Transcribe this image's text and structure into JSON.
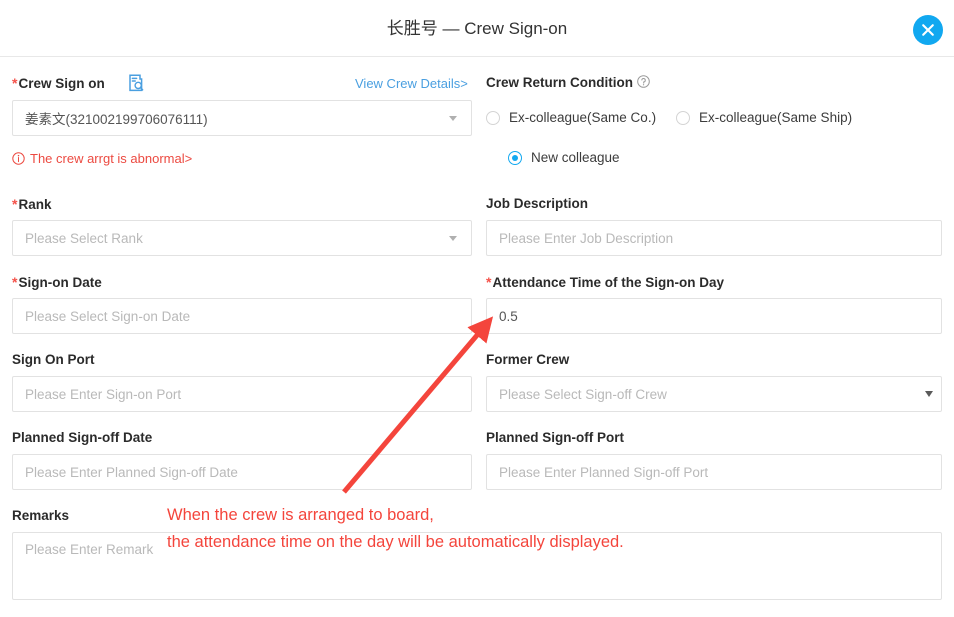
{
  "header": {
    "title": "长胜号 — Crew Sign-on",
    "close_icon": "close-icon"
  },
  "form": {
    "crew_sign_on": {
      "label": "Crew Sign on",
      "required": true,
      "icon": "document-search-icon",
      "link": "View Crew Details>",
      "value": "姜素文(321002199706076111)",
      "error": "The crew arrgt is abnormal>",
      "error_icon": "info-circle-icon"
    },
    "crew_return_condition": {
      "label": "Crew Return Condition",
      "help_icon": "question-circle-icon",
      "options": [
        {
          "label": "Ex-colleague(Same Co.)",
          "checked": false
        },
        {
          "label": "Ex-colleague(Same Ship)",
          "checked": false
        },
        {
          "label": "New colleague",
          "checked": true
        }
      ]
    },
    "rank": {
      "label": "Rank",
      "required": true,
      "placeholder": "Please Select Rank",
      "value": ""
    },
    "job_description": {
      "label": "Job Description",
      "required": false,
      "placeholder": "Please Enter Job Description",
      "value": ""
    },
    "sign_on_date": {
      "label": "Sign-on Date",
      "required": true,
      "placeholder": "Please Select Sign-on Date",
      "value": ""
    },
    "attendance_time": {
      "label": "Attendance Time of the Sign-on Day",
      "required": true,
      "placeholder": "",
      "value": "0.5"
    },
    "sign_on_port": {
      "label": "Sign On Port",
      "required": false,
      "placeholder": "Please Enter Sign-on Port",
      "value": ""
    },
    "former_crew": {
      "label": "Former Crew",
      "required": false,
      "placeholder": "Please Select Sign-off Crew",
      "value": ""
    },
    "planned_signoff_date": {
      "label": "Planned Sign-off Date",
      "required": false,
      "placeholder": "Please Enter Planned Sign-off Date",
      "value": ""
    },
    "planned_signoff_port": {
      "label": "Planned Sign-off Port",
      "required": false,
      "placeholder": "Please Enter Planned Sign-off Port",
      "value": ""
    },
    "remarks": {
      "label": "Remarks",
      "required": false,
      "placeholder": "Please Enter Remark",
      "value": ""
    }
  },
  "annotation": {
    "line1": "When the crew is arranged to board,",
    "line2": "the attendance time on the day will be automatically displayed.",
    "arrow_color": "#f4453c"
  },
  "colors": {
    "accent": "#11a8f0",
    "link": "#4a9fe0",
    "error": "#ec4a41",
    "annotation": "#f4453c",
    "border": "#e2e2e2",
    "placeholder": "#b9b9b9"
  }
}
